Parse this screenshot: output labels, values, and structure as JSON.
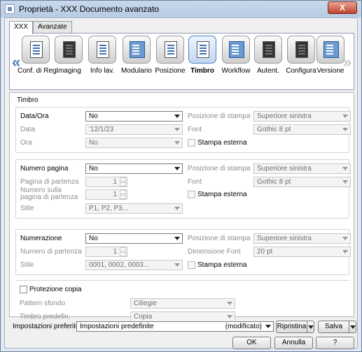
{
  "window": {
    "title": "Proprietà - XXX Documento avanzato",
    "close_label": "X"
  },
  "tabs": [
    "XXX",
    "Avanzate"
  ],
  "toolbar": {
    "left_arrow": "«",
    "right_arrow": "»",
    "items": [
      {
        "label": "Conf. di Reg.",
        "icon": "settings-doc-icon"
      },
      {
        "label": "Imaging",
        "icon": "imaging-icon"
      },
      {
        "label": "Info lav.",
        "icon": "info-icon"
      },
      {
        "label": "Modulario",
        "icon": "form-icon"
      },
      {
        "label": "Posizione",
        "icon": "position-icon"
      },
      {
        "label": "Timbro",
        "icon": "stamp-icon"
      },
      {
        "label": "Workflow",
        "icon": "workflow-icon"
      },
      {
        "label": "Autent.",
        "icon": "users-icon"
      },
      {
        "label": "Configura",
        "icon": "printer-icon"
      },
      {
        "label": "Versione",
        "icon": "version-icon"
      }
    ]
  },
  "section_title": "Timbro",
  "dateblock": {
    "label": "Data/Ora",
    "value": "No",
    "date_label": "Data",
    "date_value": "'12/1/23",
    "time_label": "Ora",
    "time_value": "No",
    "pos_label": "Posizione di stampa",
    "pos_value": "Superiore sinistra",
    "font_label": "Font",
    "font_value": "Gothic 8 pt",
    "ext_label": "Stampa esterna"
  },
  "pageblock": {
    "label": "Numero pagina",
    "value": "No",
    "start_label": "Pagina di partenza",
    "start_value": "1",
    "num_label": "Numero sulla pagina di partenza",
    "num_value": "1",
    "style_label": "Stile",
    "style_value": "P1, P2, P3...",
    "pos_label": "Posizione di stampa",
    "pos_value": "Superiore sinistra",
    "font_label": "Font",
    "font_value": "Gothic 8 pt",
    "ext_label": "Stampa esterna"
  },
  "numblock": {
    "label": "Numerazione",
    "value": "No",
    "start_label": "Numero di partenza",
    "start_value": "1",
    "style_label": "Stile",
    "style_value": "0001, 0002, 0003...",
    "pos_label": "Posizione di stampa",
    "pos_value": "Superiore sinistra",
    "size_label": "Dimensione Font",
    "size_value": "20 pt",
    "ext_label": "Stampa esterna"
  },
  "protect": {
    "label": "Protezione copia",
    "pattern_label": "Pattern sfondo",
    "pattern_value": "Ciliegie",
    "stamp_label": "Timbro predefin.",
    "stamp_value": "Copia"
  },
  "favorites": {
    "label": "Impostazioni preferite",
    "value": "Impostazioni predefinite",
    "status": "(modificato)",
    "restore": "Ripristina",
    "save": "Salva"
  },
  "dialog": {
    "ok": "OK",
    "cancel": "Annulla",
    "help": "?"
  }
}
